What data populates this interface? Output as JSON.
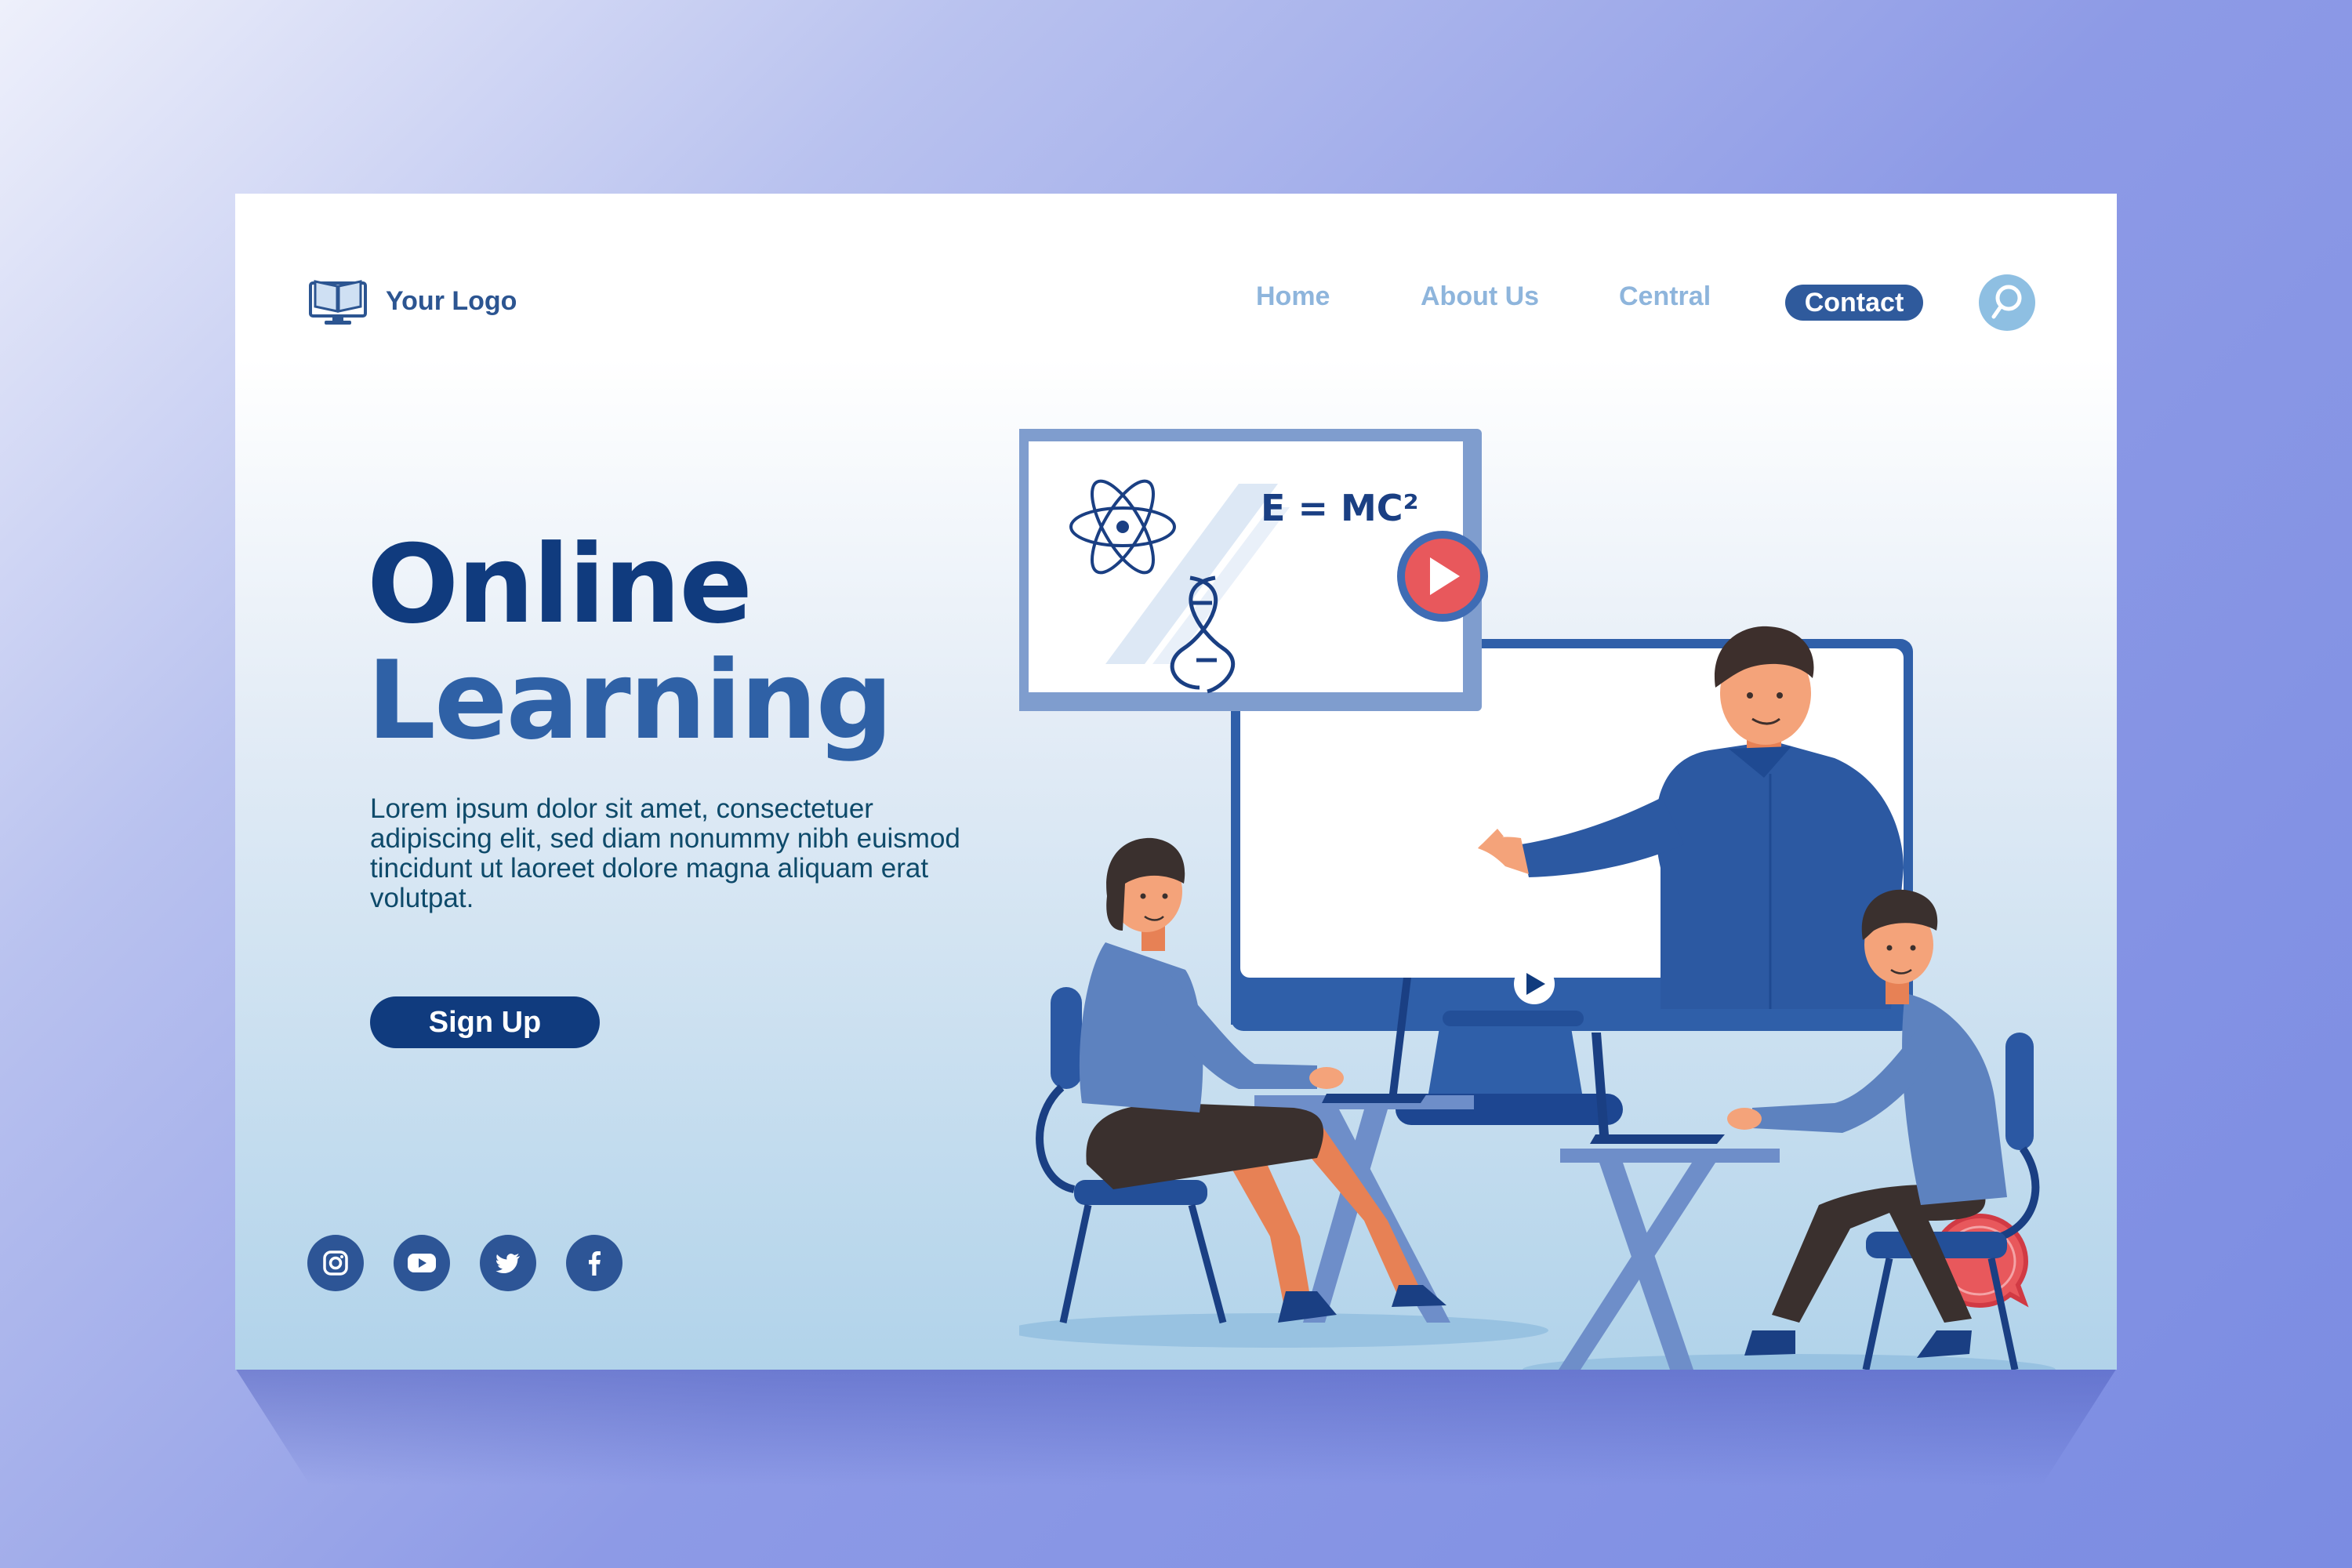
{
  "header": {
    "logo_text": "Your Logo",
    "nav": [
      {
        "label": "Home"
      },
      {
        "label": "About Us"
      },
      {
        "label": "Central"
      },
      {
        "label": "Contact"
      }
    ],
    "search_icon": "search-icon"
  },
  "hero": {
    "title_line1": "Online",
    "title_line2": "Learning",
    "description": "Lorem ipsum dolor sit amet, consectetuer adipiscing elit, sed diam nonummy nibh euismod tincidunt ut laoreet dolore magna aliquam erat volutpat.",
    "signup_label": "Sign Up"
  },
  "illustration": {
    "formula": "E = MC²"
  },
  "socials": [
    {
      "icon": "instagram-icon"
    },
    {
      "icon": "youtube-icon"
    },
    {
      "icon": "twitter-icon"
    },
    {
      "icon": "facebook-icon"
    }
  ],
  "chat_icon": "chat-bubble-icon",
  "colors": {
    "navy": "#103b7e",
    "blue": "#2f61a6",
    "nav_inactive": "#8eb5dc",
    "chat_red": "#e8585c"
  }
}
